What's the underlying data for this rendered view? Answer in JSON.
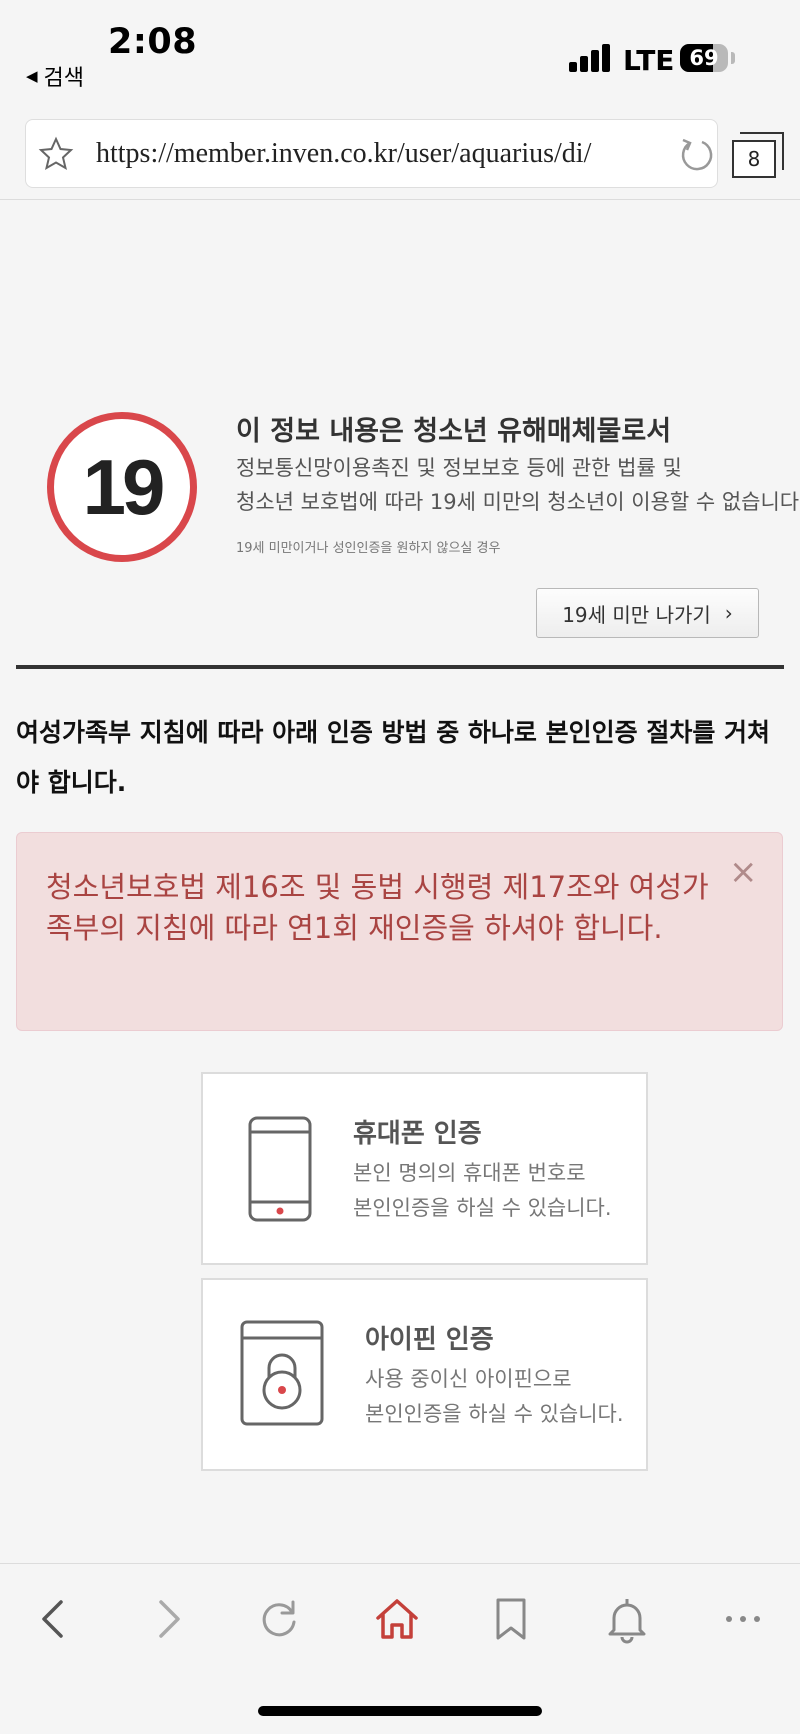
{
  "status_bar": {
    "time": "2:08",
    "back_app": "검색",
    "network": "LTE",
    "battery": "69",
    "battery_level": 0.69
  },
  "browser": {
    "url": "https://member.inven.co.kr/user/aquarius/di/",
    "tab_count": "8"
  },
  "age_warning": {
    "badge": "19",
    "title": "이 정보 내용은 청소년 유해매체물로서",
    "desc_line1": "정보통신망이용촉진 및 정보보호 등에 관한 법률 및",
    "desc_line2": "청소년 보호법에 따라 19세 미만의 청소년이 이용할 수 없습니다.",
    "note": "19세 미만이거나 성인인증을 원하지 않으실 경우",
    "exit_button": "19세 미만 나가기",
    "badge_color": "#d9474b"
  },
  "notice": "여성가족부 지침에 따라 아래 인증 방법 중 하나로 본인인증 절차를 거쳐야 합니다.",
  "alert": {
    "message": "청소년보호법 제16조 및 동법 시행령 제17조와 여성가족부의 지침에 따라 연1회 재인증을 하셔야 합니다.",
    "close": "×",
    "bg_color": "#f2dede",
    "text_color": "#a94442"
  },
  "auth_options": {
    "phone": {
      "title": "휴대폰 인증",
      "desc_line1": "본인 명의의 휴대폰 번호로",
      "desc_line2": "본인인증을 하실 수 있습니다."
    },
    "ipin": {
      "title": "아이핀 인증",
      "desc_line1": "사용 중이신 아이핀으로",
      "desc_line2": "본인인증을 하실 수 있습니다."
    }
  },
  "toolbar": {
    "icons": [
      "back-icon",
      "forward-icon",
      "refresh-icon",
      "home-icon",
      "bookmark-icon",
      "bell-icon",
      "more-icon"
    ],
    "active_color": "#c4403a"
  }
}
